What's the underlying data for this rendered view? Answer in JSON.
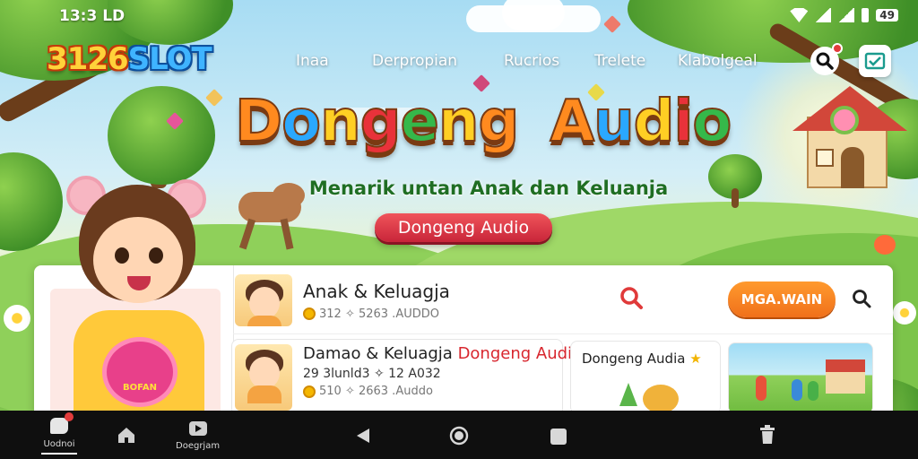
{
  "status_bar": {
    "time": "13:3 LD",
    "battery": "49"
  },
  "header": {
    "logo_num": "3126",
    "logo_slot": "SLOT",
    "nav": [
      "Inaa",
      "Derpropian",
      "Rucrios",
      "Trelete",
      "Klabolgeal"
    ]
  },
  "hero": {
    "title_word1": "Dongeng",
    "title_word2": "Audio",
    "subtitle": "Menarik untan Anak dan Keluanja",
    "cta_label": "Dongeng Audio"
  },
  "featured_panel": {
    "badge_text": "BOFAN"
  },
  "list": {
    "item1": {
      "title": "Anak & Keluagja",
      "meta": "312 ✧ 5263 .AUDDO"
    },
    "item2": {
      "title_a": "Damao & Keluagja",
      "title_b": "Dongeng Audi",
      "meta_line": "29 3lunld3 ✧ 12 A032",
      "meta": "510 ✧ 2663 .Auddo"
    }
  },
  "play_button_label": "MGA.WAIN",
  "subcards": {
    "card1_title": "Dongeng Audia"
  },
  "bottom_nav": {
    "items": [
      {
        "label": "Uodnoi",
        "icon": "chat-icon"
      },
      {
        "label": "",
        "icon": "home-icon"
      },
      {
        "label": "Doegrjam",
        "icon": "video-icon"
      }
    ]
  },
  "colors": {
    "title_palette": [
      "#ff8a1f",
      "#2aa8ff",
      "#ffcf24",
      "#e8323a",
      "#35b84a",
      "#ffcf24",
      "#ff8a1f"
    ],
    "cta_red": "#d83040",
    "play_orange": "#f57f22",
    "subtitle_green": "#1f6e23"
  }
}
